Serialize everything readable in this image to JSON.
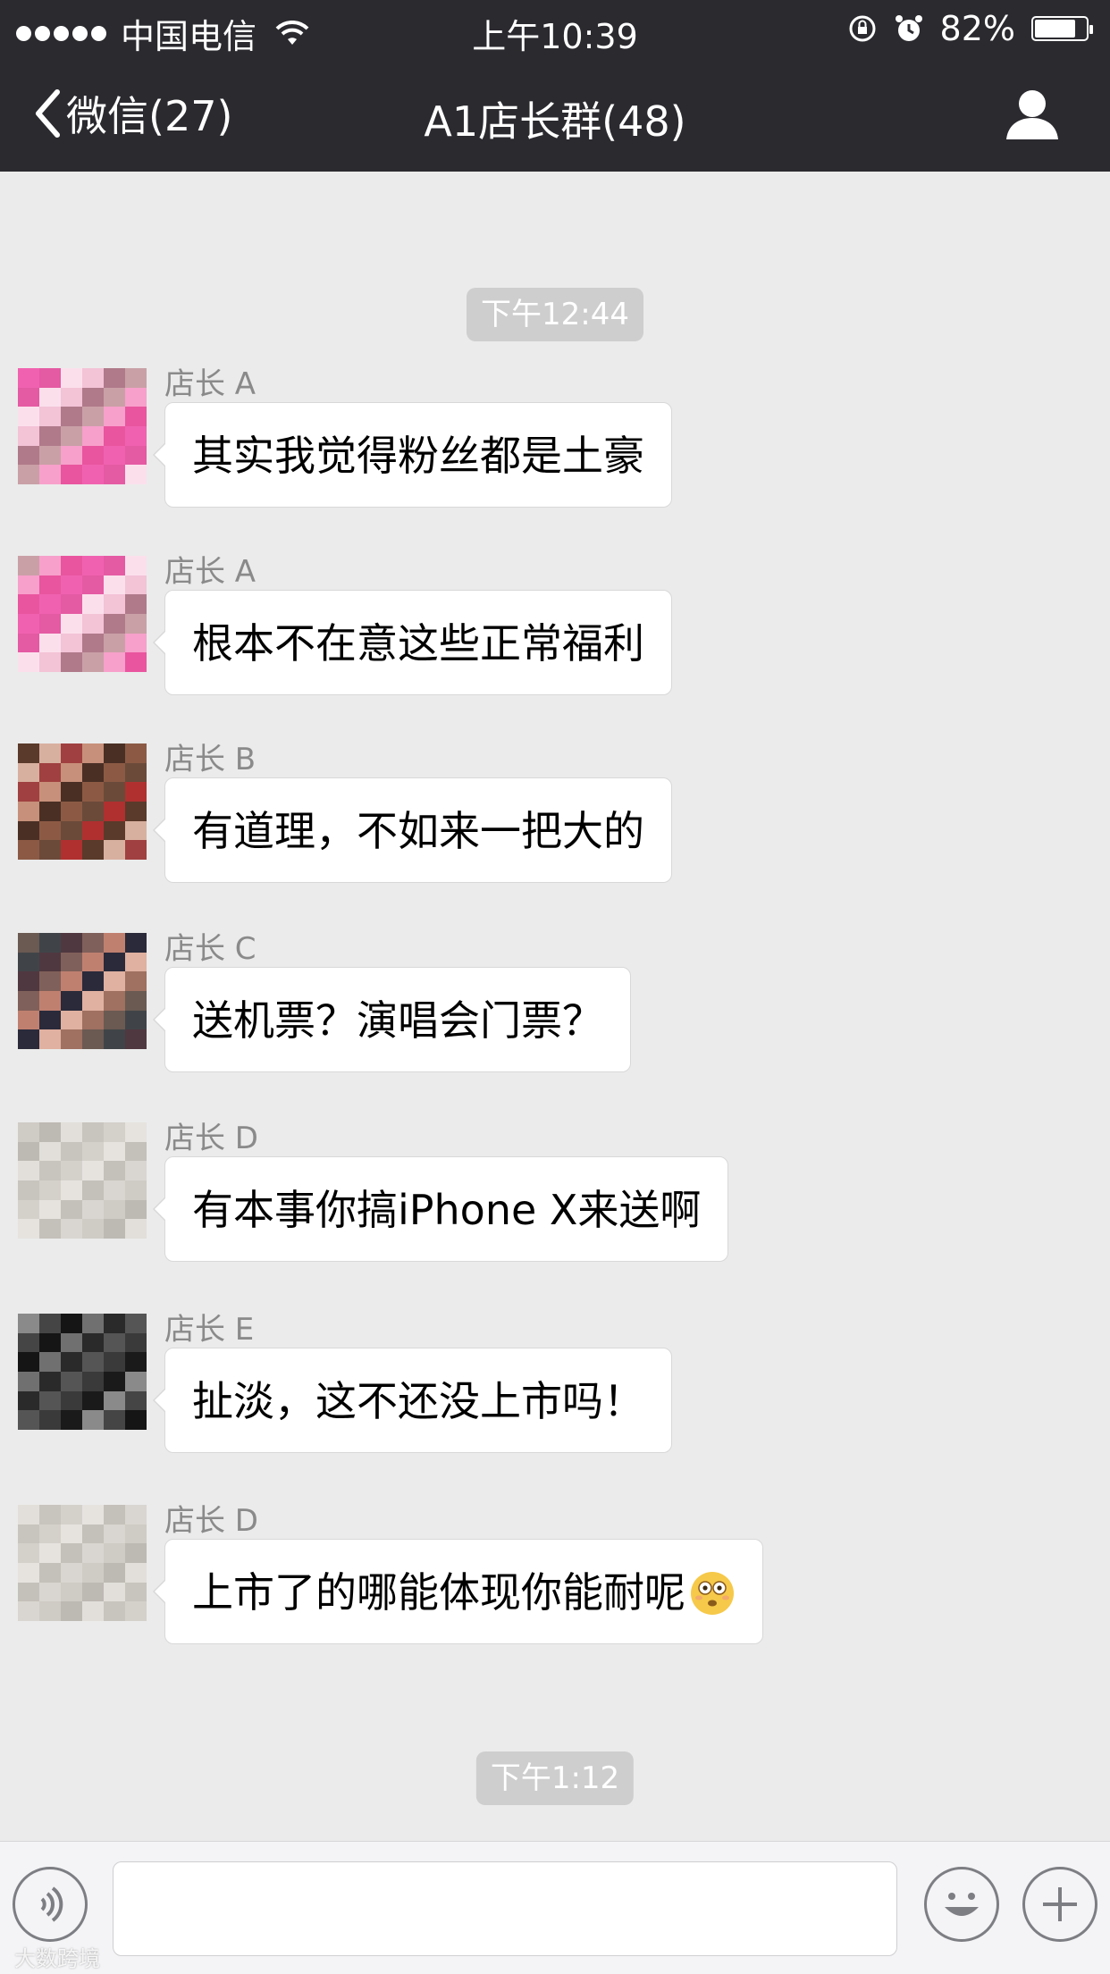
{
  "status_bar": {
    "carrier": "中国电信",
    "time": "上午10:39",
    "battery_text": "82%",
    "battery_level": 0.82
  },
  "nav": {
    "back_label": "微信(27)",
    "title": "A1店长群(48)"
  },
  "timestamps": [
    "下午12:44",
    "下午1:12"
  ],
  "messages": [
    {
      "sender": "店长 A",
      "text": "其实我觉得粉丝都是土豪",
      "emoji": ""
    },
    {
      "sender": "店长 A",
      "text": "根本不在意这些正常福利",
      "emoji": ""
    },
    {
      "sender": "店长 B",
      "text": "有道理，不如来一把大的",
      "emoji": ""
    },
    {
      "sender": "店长 C",
      "text": "送机票？演唱会门票？",
      "emoji": ""
    },
    {
      "sender": "店长 D",
      "text": "有本事你搞iPhone X来送啊",
      "emoji": ""
    },
    {
      "sender": "店长 E",
      "text": "扯淡，这不还没上市吗！",
      "emoji": ""
    },
    {
      "sender": "店长 D",
      "text": "上市了的哪能体现你能耐呢",
      "emoji": "flushed-emoji"
    }
  ],
  "watermark": "大数跨境",
  "colors": {
    "header_bg": "#2b2a2f",
    "chat_bg": "#ebebeb",
    "bubble_bg": "#ffffff",
    "timestamp_bg": "#cecece"
  }
}
